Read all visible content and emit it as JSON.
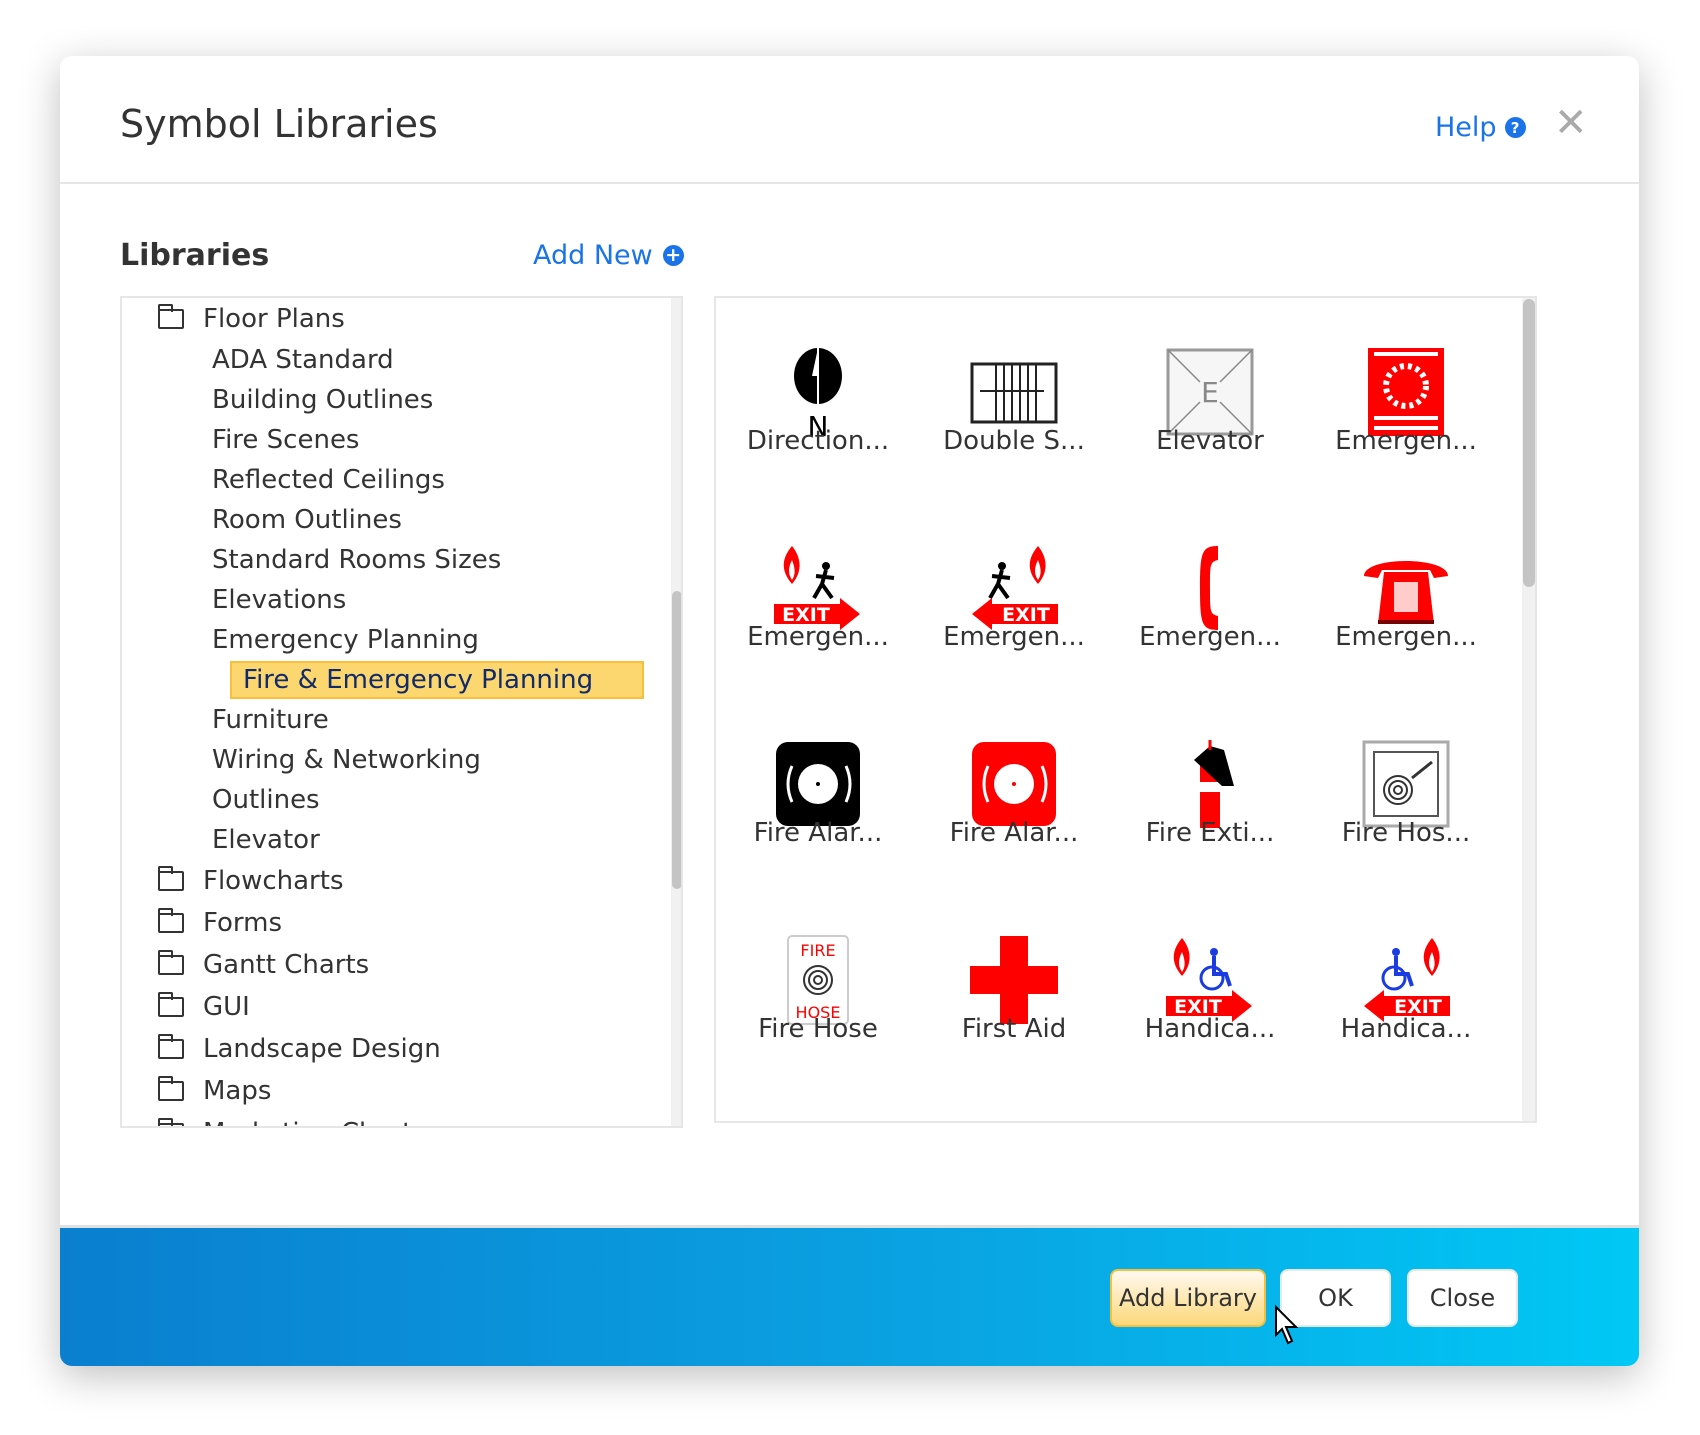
{
  "dialog": {
    "title": "Symbol Libraries",
    "help_label": "Help",
    "help_icon": "question-circle-icon",
    "close_icon": "close-icon"
  },
  "libraries": {
    "heading": "Libraries",
    "add_new_label": "Add New",
    "add_new_icon": "plus-circle-icon",
    "tree": [
      {
        "label": "Floor Plans",
        "type": "folder"
      },
      {
        "label": "ADA Standard",
        "type": "sub"
      },
      {
        "label": "Building Outlines",
        "type": "sub"
      },
      {
        "label": "Fire Scenes",
        "type": "sub"
      },
      {
        "label": "Reflected Ceilings",
        "type": "sub"
      },
      {
        "label": "Room Outlines",
        "type": "sub"
      },
      {
        "label": "Standard Rooms Sizes",
        "type": "sub"
      },
      {
        "label": "Elevations",
        "type": "sub"
      },
      {
        "label": "Emergency Planning",
        "type": "sub"
      },
      {
        "label": "Fire & Emergency Planning",
        "type": "selected"
      },
      {
        "label": "Furniture",
        "type": "sub"
      },
      {
        "label": "Wiring & Networking",
        "type": "sub"
      },
      {
        "label": "Outlines",
        "type": "sub"
      },
      {
        "label": "Elevator",
        "type": "sub"
      },
      {
        "label": "Flowcharts",
        "type": "folder"
      },
      {
        "label": "Forms",
        "type": "folder"
      },
      {
        "label": "Gantt Charts",
        "type": "folder"
      },
      {
        "label": "GUI",
        "type": "folder"
      },
      {
        "label": "Landscape Design",
        "type": "folder"
      },
      {
        "label": "Maps",
        "type": "folder"
      },
      {
        "label": "Marketing Charts",
        "type": "folder"
      }
    ]
  },
  "symbols": [
    {
      "label": "Direction...",
      "icon": "north-arrow-icon"
    },
    {
      "label": "Double S...",
      "icon": "double-sink-icon"
    },
    {
      "label": "Elevator",
      "icon": "elevator-icon"
    },
    {
      "label": "Emergen...",
      "icon": "emergency-dial-911-icon"
    },
    {
      "label": "Emergen...",
      "icon": "exit-right-fire-icon"
    },
    {
      "label": "Emergen...",
      "icon": "exit-left-fire-icon"
    },
    {
      "label": "Emergen...",
      "icon": "phone-handset-icon"
    },
    {
      "label": "Emergen...",
      "icon": "telephone-icon"
    },
    {
      "label": "Fire Alar...",
      "icon": "fire-alarm-black-icon"
    },
    {
      "label": "Fire Alar...",
      "icon": "fire-alarm-red-icon"
    },
    {
      "label": "Fire Exti...",
      "icon": "fire-extinguisher-icon"
    },
    {
      "label": "Fire Hos...",
      "icon": "fire-hose-reel-icon"
    },
    {
      "label": "Fire Hose",
      "icon": "fire-hose-sign-icon",
      "sign_top": "FIRE",
      "sign_bottom": "HOSE"
    },
    {
      "label": "First Aid",
      "icon": "first-aid-cross-icon"
    },
    {
      "label": "Handica...",
      "icon": "handicap-exit-right-icon"
    },
    {
      "label": "Handica...",
      "icon": "handicap-exit-left-icon"
    }
  ],
  "exit_text": "EXIT",
  "elevator_letter": "E",
  "north_letter": "N",
  "footer": {
    "add_library_label": "Add Library",
    "ok_label": "OK",
    "close_label": "Close"
  },
  "colors": {
    "accent": "#1a73e8",
    "selected_bg": "#fcd66e",
    "footer_start": "#0a7fcf",
    "footer_end": "#00c8f5",
    "symbol_red": "#ff0000"
  }
}
